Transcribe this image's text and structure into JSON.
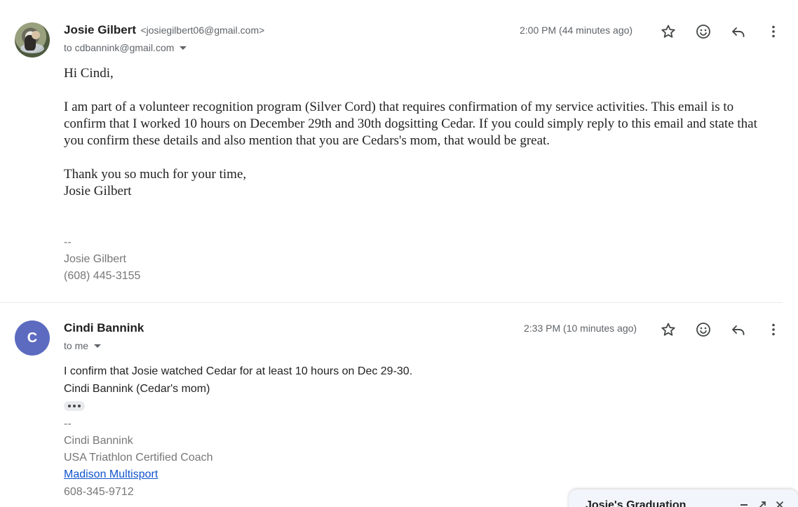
{
  "messages": [
    {
      "sender_name": "Josie Gilbert",
      "sender_email": "<josiegilbert06@gmail.com>",
      "recipient": "to cdbannink@gmail.com",
      "timestamp": "2:00 PM (44 minutes ago)",
      "body": [
        "Hi Cindi,",
        "I am part of a volunteer recognition program (Silver Cord) that requires confirmation of my service activities. This email is to confirm that I worked 10 hours on December 29th and 30th dogsitting Cedar. If you could simply reply to this email and state that you confirm these details and also mention that you are Cedars's mom, that would be great.",
        "Thank you so much for your time,",
        "Josie Gilbert"
      ],
      "signature": [
        "--",
        "Josie Gilbert",
        "(608) 445-3155"
      ]
    },
    {
      "sender_name": "Cindi Bannink",
      "avatar_letter": "C",
      "recipient": "to me",
      "timestamp": "2:33 PM (10 minutes ago)",
      "body": [
        "I confirm that Josie watched Cedar for at least 10 hours on Dec 29-30.",
        "Cindi Bannink (Cedar's mom)"
      ],
      "signature": [
        "--",
        "Cindi Bannink",
        "USA Triathlon Certified Coach",
        "Madison Multisport",
        "608-345-9712"
      ]
    }
  ],
  "compose": {
    "title": "Josie's Graduation"
  },
  "colors": {
    "avatar_c": "#5c6bc0",
    "link": "#1155cc",
    "icon": "#444746"
  },
  "icons": [
    "star-icon",
    "emoji-icon",
    "reply-icon",
    "more-vert-icon",
    "dropdown-caret-icon",
    "minimize-icon",
    "popout-icon",
    "close-icon"
  ]
}
